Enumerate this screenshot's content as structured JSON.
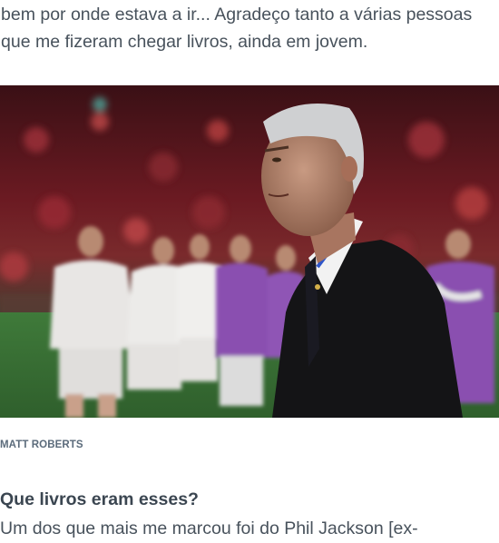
{
  "article": {
    "intro_paragraph": "bem por onde estava a ir... Agradeço tanto a várias pessoas que me fizeram chegar livros, ainda em jovem.",
    "image_credit": "MATT ROBERTS",
    "question": "Que livros eram esses?",
    "answer_start": "Um dos que mais me marcou foi do Phil Jackson [ex-"
  }
}
